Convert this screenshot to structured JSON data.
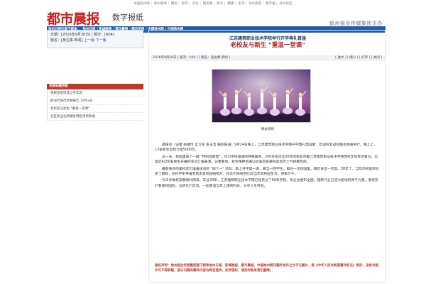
{
  "topnav": [
    "中国徐州网",
    "徐州新闻",
    "网视",
    "影音",
    "问答",
    "网友圈",
    "新声",
    "健康",
    "生活",
    "徐州旅游",
    "数字报",
    "徐州社区"
  ],
  "header": {
    "logo": "都市晨报",
    "logo_sub": "数字报纸",
    "links": [
      "徐州日报社旗下媒体：",
      "徐州日报",
      "彭城晚报",
      "都市晨报",
      "都市早报",
      "中国徐州网",
      "中国徐州网"
    ],
    "group": "徐州报业传媒集团主办"
  },
  "issue": {
    "date_label": "日期：",
    "date": "2016年9月26日",
    "page_label": "版次：",
    "page": "A04",
    "section_label": "版名：",
    "section": "身边事·新闻",
    "prev": "上一版",
    "next": "下一版"
  },
  "sidebar": {
    "title": "本版标题导航",
    "items": [
      "保税星组织成立半年后",
      "欧洲元阳市新闻报告 10月3日",
      "老校友与新生 \"重温一堂课\"",
      "社区新业态新健身特色项目改进"
    ]
  },
  "article": {
    "subtitle": "江苏建筑职业技术学院举行开学典礼首届",
    "title": "老校友与新生 \"重温一堂课\"",
    "meta_left": "2016年9月26日  [ 版次：A04 ]  [ 版名：身边事·新闻 ]",
    "meta_right": "[ 放大 ] [ 缩小 ] [ 打印 ] [ 关闭 ]",
    "caption": "晚会现场",
    "paragraphs": [
      "晨报讯（记者 张敏玲 实习生 张玉洁 摄影报道）9月24日晚上，江苏建筑职业技术学院开学典礼暨迎新、欢迎校友返校晚会隆重举行。晚上上，13名新生自我介绍5000元。",
      "这一天，校园里来了一群 \"特别观察团\"。作为学校邀请的特殊嘉宾，200多名毕业30年的校友齐聚江苏建筑职业技术学院西校区体育场看台，出席近4200名新生开展的军训汇报表演。记者看到，新生精神饱满以标准的军姿和高昂的士气接受检阅。",
      "最有看点的是校友们准备体验的 \"四个一\" 活动：再上开学第一课，再当一回学生，再住一次校园里，再吃食堂一次饭。30年了，当年的校园早已变了模样，在校学生带着老校友逛校园拍照片。校友们纷纷回忆起当年的校园生活，感慨万千。",
      "今日多数校友都如约而来，毕业30年，江苏建筑职业技术学院已经走过了60年历程，毕业生遍布全国，建筑行业已成为各地的骨干力量。老校友们参观校园后，与新生们交流，一起重温当年上课的时光，分享人生经验。"
    ]
  },
  "copyright": "版权声明：徐州报业传媒集团旗下媒体徐州日报、彭城晚报、都市晨报、中国徐州网刊载所发布之文字与图片，受《中华人民共和国著作权法》保护，未经书面许可不得转载，部分刊载的稿件内容为网友提供，如涉侵权，请及时联系我们删除。"
}
